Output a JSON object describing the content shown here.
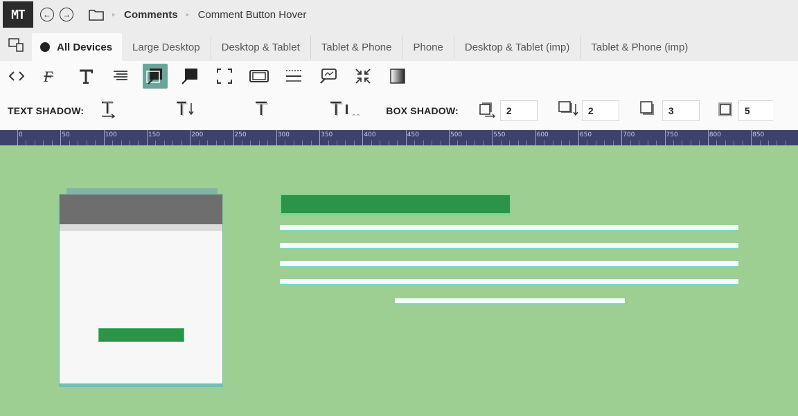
{
  "app": {
    "logo_text": "MT",
    "back_glyph": "←",
    "forward_glyph": "→"
  },
  "breadcrumb": {
    "item1": "Comments",
    "item2": "Comment Button Hover",
    "separator": "▸"
  },
  "tabs": [
    {
      "label": "All Devices",
      "active": true
    },
    {
      "label": "Large Desktop"
    },
    {
      "label": "Desktop & Tablet"
    },
    {
      "label": "Tablet & Phone"
    },
    {
      "label": "Phone"
    },
    {
      "label": "Desktop & Tablet (imp)"
    },
    {
      "label": "Tablet & Phone (imp)"
    }
  ],
  "toolbar": {
    "tools": [
      "code-icon",
      "font-icon",
      "text-icon",
      "align-icon",
      "box-shadow-tool-icon",
      "speech-bubble-icon",
      "fullscreen-icon",
      "film-icon",
      "border-icon",
      "chat-icon",
      "collapse-icon",
      "gradient-icon"
    ],
    "active_tool": "box-shadow-tool-icon",
    "accent": "#6aa59a"
  },
  "shadow": {
    "text_label": "TEXT SHADOW:",
    "box_label": "BOX SHADOW:",
    "box_values": [
      "2",
      "2",
      "3",
      "5"
    ]
  },
  "ruler": {
    "labels": [
      "0",
      "50",
      "100",
      "150",
      "200",
      "250",
      "300",
      "350",
      "400",
      "450",
      "500",
      "550",
      "600",
      "650",
      "700",
      "750",
      "800",
      "850"
    ]
  },
  "colors": {
    "canvas": "#9ccf91",
    "button_green": "#2b9448",
    "card_header": "#6e6e6e",
    "ruler_bg": "#3e416a"
  }
}
